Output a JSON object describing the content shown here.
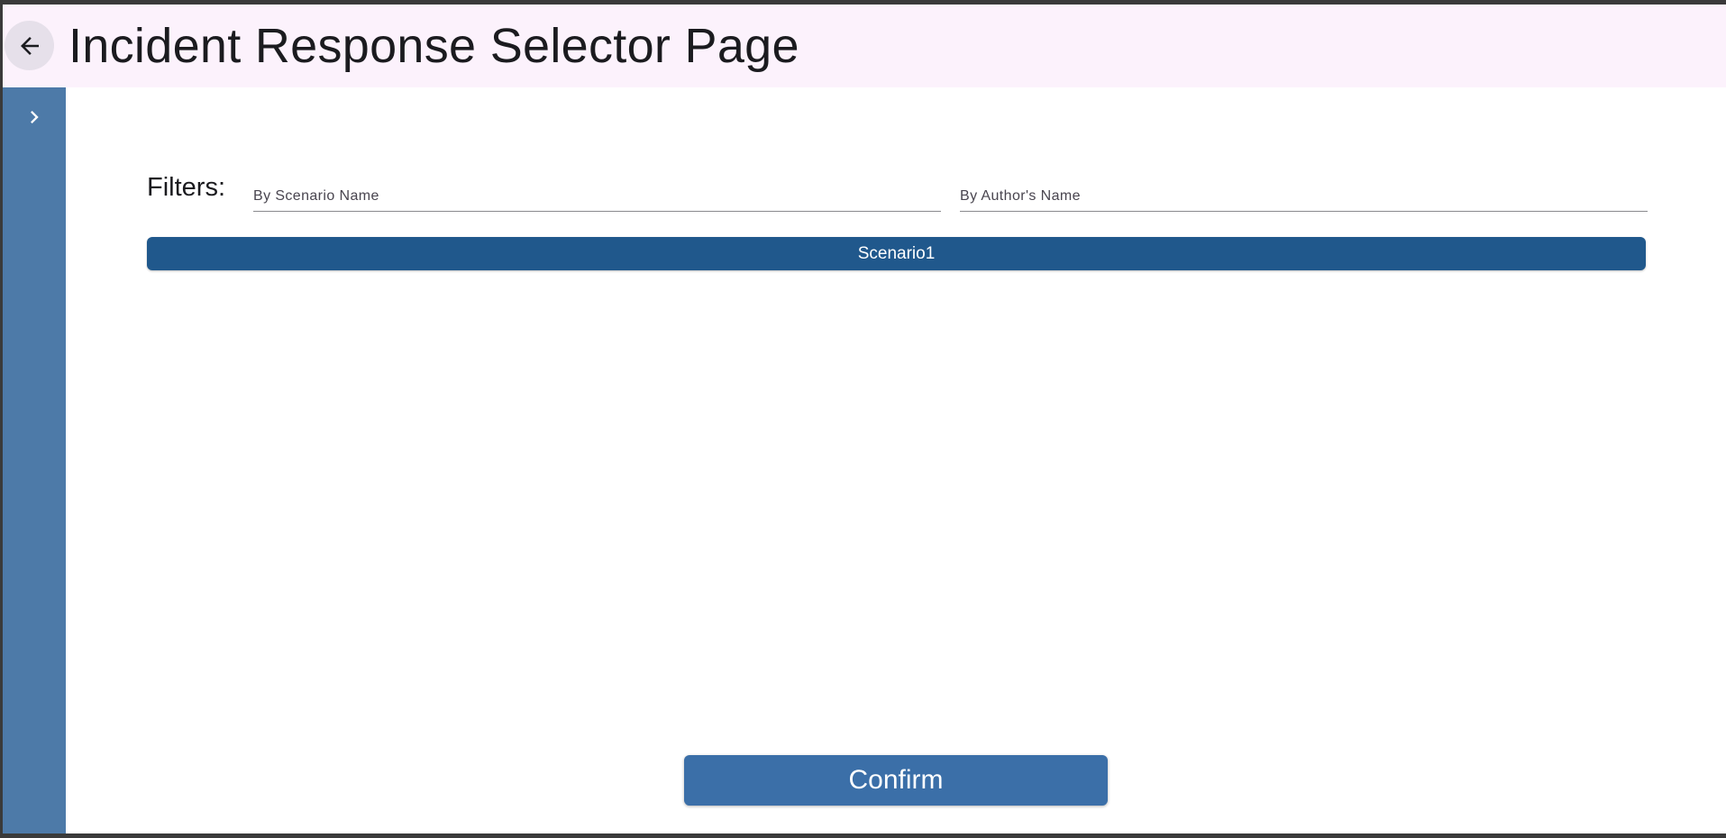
{
  "app_bar": {
    "title": "Incident Response Selector Page",
    "back_icon": "arrow-left-icon"
  },
  "sidebar": {
    "toggle_icon": "chevron-right-icon"
  },
  "filters": {
    "label": "Filters:",
    "scenario_name": {
      "placeholder": "By Scenario Name",
      "value": ""
    },
    "author_name": {
      "placeholder": "By Author's Name",
      "value": ""
    }
  },
  "scenarios": [
    {
      "label": "Scenario1"
    }
  ],
  "actions": {
    "confirm_label": "Confirm"
  },
  "colors": {
    "app_bar_bg": "#fcf2fc",
    "sidebar_bg": "#4d7aa8",
    "scenario_item_bg": "#20588c",
    "confirm_bg": "#3b6fa8"
  }
}
